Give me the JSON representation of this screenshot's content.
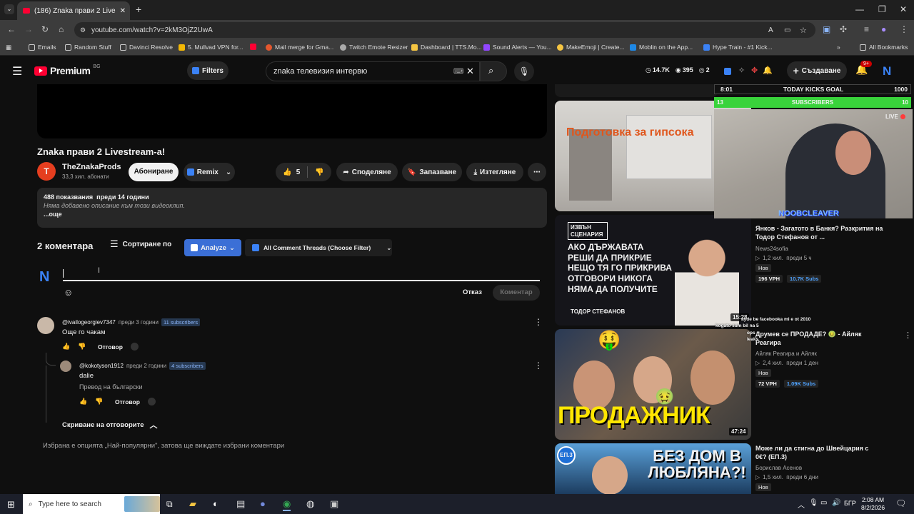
{
  "browser": {
    "tab_title": "(186) Znaka прави 2 Livestr...",
    "url": "youtube.com/watch?v=2kM3OjZ2UwA",
    "bookmarks": [
      "Emails",
      "Random Stuff",
      "Davinci Resolve",
      "5. Mullvad VPN for...",
      "Mail merge for Gma...",
      "Twitch Emote Resizer",
      "Dashboard | TTS.Mo...",
      "Sound Alerts — You...",
      "MakeEmoji | Create...",
      "Moblin on the App...",
      "Hype Train - #1 Kick..."
    ],
    "all_bookmarks": "All Bookmarks"
  },
  "masthead": {
    "logo": "Premium",
    "region": "BG",
    "filters": "Filters",
    "search_value": "znaka телевизия интервю",
    "stats": [
      "14.7K",
      "395",
      "2"
    ],
    "create": "Създаване",
    "notif_count": "9+"
  },
  "video": {
    "title": "Znaka прави 2 Livestream-a!",
    "channel": "TheZnakaProds",
    "subs": "33,3 хил. абонати",
    "subscribe": "Абониране",
    "remix": "Remix",
    "likes": "5",
    "share": "Споделяне",
    "save": "Запазване",
    "download": "Изтегляне",
    "views": "488 показвания  преди 14 години",
    "desc": "Няма добавено описание към този видеоклип.",
    "more": "...още"
  },
  "comments": {
    "count": "2 коментара",
    "sort": "Сортиране по",
    "analyze": "Analyze",
    "thread_filter": "All Comment Threads (Choose Filter)",
    "cancel": "Отказ",
    "submit": "Коментар",
    "items": [
      {
        "user": "@ivailogeorgiev7347",
        "time": "преди 3 години",
        "badge": "11 subscribers",
        "text": "Още го чакам",
        "reply": "Отговор"
      },
      {
        "user": "@kokotyson1912",
        "time": "преди 2 години",
        "badge": "4 subscribers",
        "text": "dalie",
        "translate": "Превод на български",
        "reply": "Отговор"
      }
    ],
    "hide_replies": "Скриване на отговорите",
    "footer": "Избрана е опцията „Най-популярни\", затова ще виждате избрани коментари"
  },
  "overlay": {
    "timer": "8:01",
    "goal": "TODAY KICKS GOAL",
    "goal_value": "1000",
    "subs_left": "13",
    "subs_label": "SUBSCRIBERS",
    "subs_right": "10",
    "live": "LIVE",
    "streamer": "NOOBCLEAVER",
    "chat": [
      "ayde be facebooka mi e ot 2010",
      "kogato sum bil na 5",
      "ops",
      "leaks"
    ]
  },
  "related": [
    {
      "thumb_text": "Подготовка за гипсока"
    },
    {
      "title": "Янков - Загатото в Банкя? Разкрития на Тодор Стефанов от ...",
      "channel": "News24sofia",
      "meta": "1,2 хил.  преди 5 ч",
      "tag": "Нов",
      "vph": "196 VPH",
      "subs": "10.7K Subs",
      "duration": "15:28",
      "thumb_lines": [
        "АКО ДЪРЖАВАТА",
        "РЕШИ ДА ПРИКРИЕ",
        "НЕЩО ТЯ ГО ПРИКРИВА",
        "ОТГОВОРИ НИКОГА",
        "НЯМА ДА ПОЛУЧИТЕ"
      ],
      "thumb_badge": "ИЗВЪН СЦЕНАРИЯ",
      "thumb_name": "ТОДОР СТЕФАНОВ"
    },
    {
      "title": "Друмев се ПРОДАДЕ? 🤢 - Айляк Реагира",
      "channel": "Айляк Реагира и Айляк",
      "meta": "2,4 хил.  преди 1 ден",
      "tag": "Нов",
      "vph": "72 VPH",
      "subs": "1.09K Subs",
      "duration": "47:24",
      "thumb_text": "ПРОДАЖНИК"
    },
    {
      "title": "Може ли да стигна до Швейцария с 0€? (ЕП.3)",
      "channel": "Борислав Асенов",
      "meta": "1,5 хил.  преди 6 дни",
      "tag": "Нов",
      "thumb_text": "БЕЗ ДОМ В ЛЮБЛЯНА?!",
      "ep": "ЕП.3"
    }
  ],
  "taskbar": {
    "search": "Type here to search",
    "lang": "БГР",
    "time": "2:08 AM",
    "date": "8/2/2026"
  }
}
